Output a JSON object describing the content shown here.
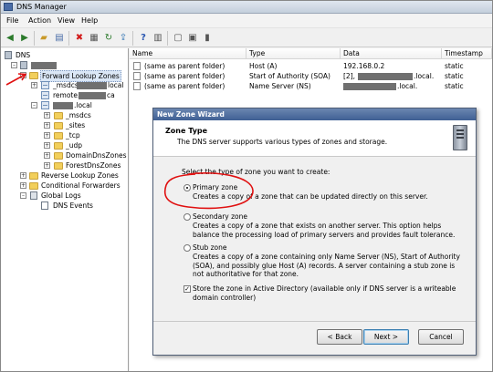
{
  "window": {
    "title": "DNS Manager"
  },
  "menu": [
    "File",
    "Action",
    "View",
    "Help"
  ],
  "toolbar_icons": [
    "back-arrow-icon",
    "forward-arrow-icon",
    "up-folder-icon",
    "show-hide-tree-icon",
    "delete-icon",
    "properties-icon",
    "refresh-icon",
    "export-list-icon",
    "help-icon",
    "view-icon",
    "new-record-icon",
    "new-zone-icon",
    "server-icon"
  ],
  "tree": {
    "root": "DNS",
    "forward": "Forward Lookup Zones",
    "msdcs_prefix": "_msdcs.",
    "msdcs_suffix": "local",
    "remote_prefix": "remote.",
    "remote_suffix": "ca",
    "local_suffix": ".local",
    "sub_msdcs": "_msdcs",
    "sub_sites": "_sites",
    "sub_tcp": "_tcp",
    "sub_udp": "_udp",
    "domaindns": "DomainDnsZones",
    "forestdns": "ForestDnsZones",
    "reverse": "Reverse Lookup Zones",
    "conditional": "Conditional Forwarders",
    "globallogs": "Global Logs",
    "dnsevents": "DNS Events"
  },
  "list": {
    "columns": [
      "Name",
      "Type",
      "Data",
      "Timestamp"
    ],
    "rows": [
      {
        "name": "(same as parent folder)",
        "type": "Host (A)",
        "data": "192.168.0.2",
        "timestamp": "static"
      },
      {
        "name": "(same as parent folder)",
        "type": "Start of Authority (SOA)",
        "data_pre": "[2],",
        "data_post": ".local.",
        "timestamp": "static"
      },
      {
        "name": "(same as parent folder)",
        "type": "Name Server (NS)",
        "data_post": ".local.",
        "timestamp": "static"
      }
    ]
  },
  "wizard": {
    "title": "New Zone Wizard",
    "heading": "Zone Type",
    "subheading": "The DNS server supports various types of zones and storage.",
    "prompt": "Select the type of zone you want to create:",
    "options": [
      {
        "label": "Primary zone",
        "desc": "Creates a copy of a zone that can be updated directly on this server.",
        "selected": true
      },
      {
        "label": "Secondary zone",
        "desc": "Creates a copy of a zone that exists on another server. This option helps balance the processing load of primary servers and provides fault tolerance.",
        "selected": false
      },
      {
        "label": "Stub zone",
        "desc": "Creates a copy of a zone containing only Name Server (NS), Start of Authority (SOA), and possibly glue Host (A) records. A server containing a stub zone is not authoritative for that zone.",
        "selected": false
      }
    ],
    "store_ad": {
      "label": "Store the zone in Active Directory (available only if DNS server is a writeable domain controller)",
      "checked": true,
      "mark": "✓"
    },
    "buttons": {
      "back": "< Back",
      "next": "Next >",
      "cancel": "Cancel"
    }
  },
  "colors": {
    "annotation": "#e01010",
    "title_gradient_end": "#3f5f94",
    "selection": "#dbe7f6"
  }
}
